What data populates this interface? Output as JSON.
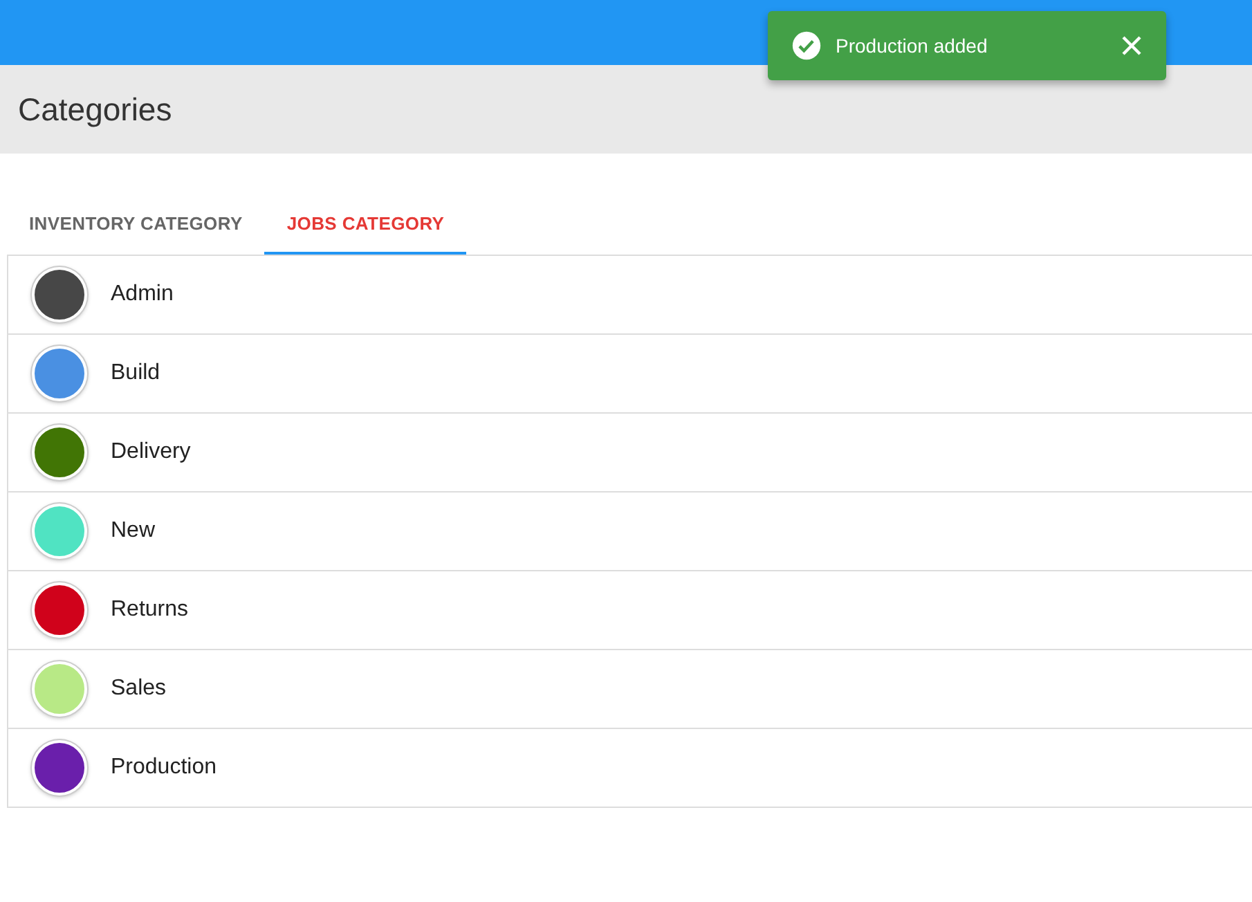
{
  "page_title": "Categories",
  "tabs": [
    {
      "label": "INVENTORY CATEGORY",
      "selected": false
    },
    {
      "label": "JOBS CATEGORY",
      "selected": true
    }
  ],
  "categories": [
    {
      "name": "Admin",
      "color": "#474747"
    },
    {
      "name": "Build",
      "color": "#4a90e2"
    },
    {
      "name": "Delivery",
      "color": "#417505"
    },
    {
      "name": "New",
      "color": "#50e3c2"
    },
    {
      "name": "Returns",
      "color": "#d0021b"
    },
    {
      "name": "Sales",
      "color": "#b8e986"
    },
    {
      "name": "Production",
      "color": "#6a1fab"
    }
  ],
  "toast": {
    "message": "Production added"
  }
}
